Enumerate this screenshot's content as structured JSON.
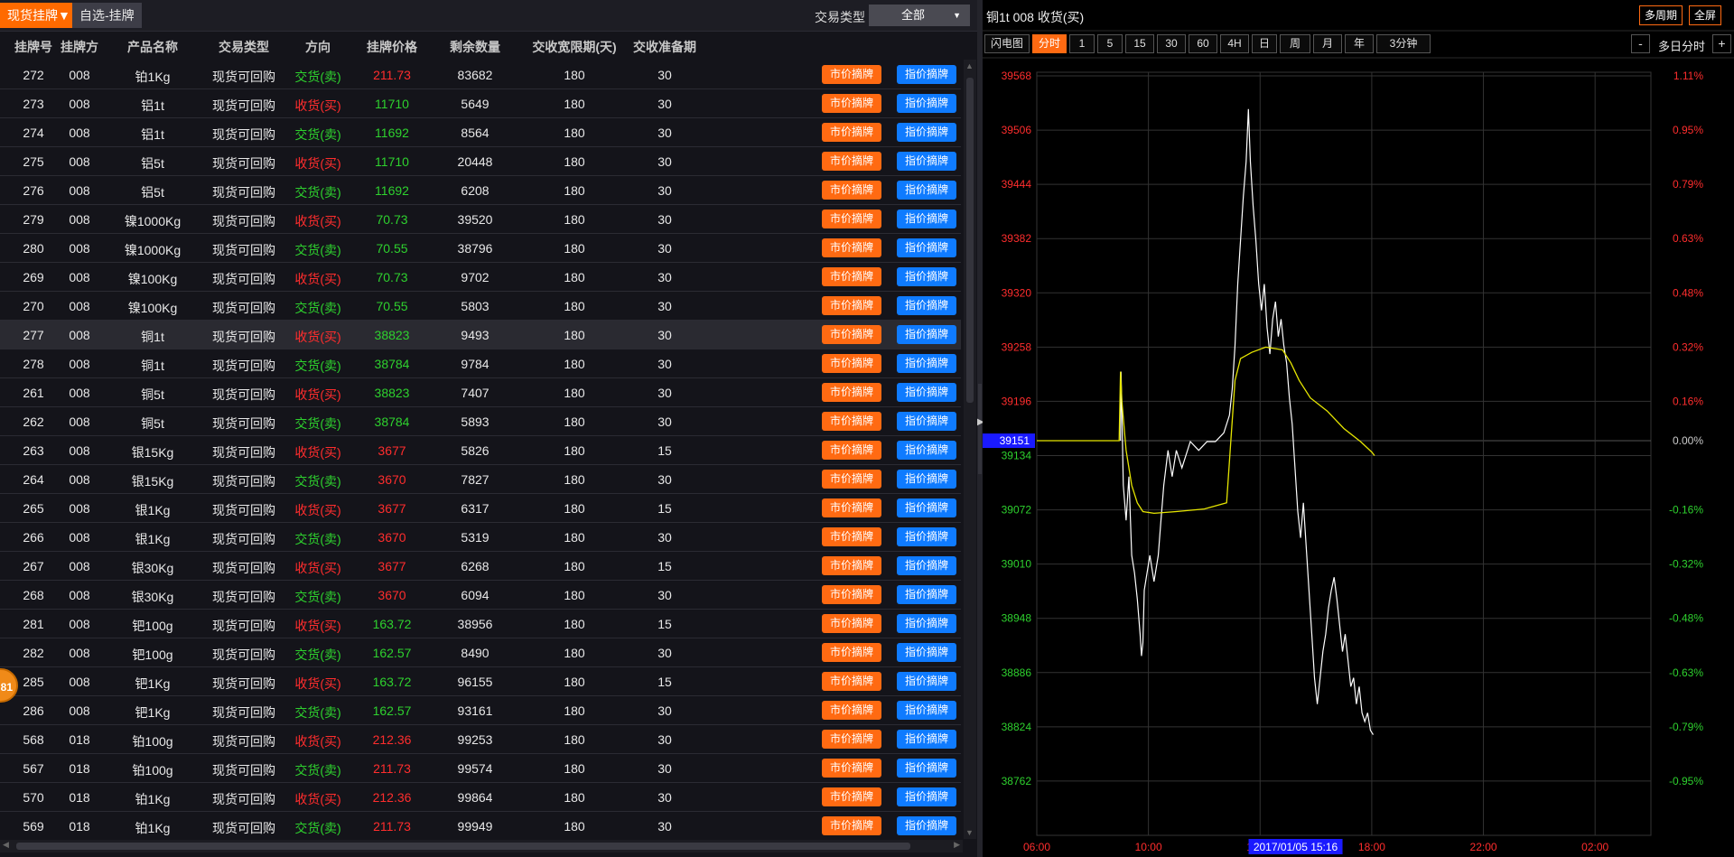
{
  "tabs": {
    "active": "现货挂牌▼",
    "other": "自选-挂牌"
  },
  "filter": {
    "label": "交易类型",
    "selected": "全部"
  },
  "table": {
    "headers": [
      "挂牌号",
      "挂牌方",
      "产品名称",
      "交易类型",
      "方向",
      "挂牌价格",
      "剩余数量",
      "交收宽限期(天)",
      "交收准备期"
    ],
    "buttons": {
      "market": "市价摘牌",
      "limit": "指价摘牌"
    },
    "rows": [
      {
        "id": "272",
        "party": "008",
        "product": "铂1Kg",
        "type": "现货可回购",
        "dir": "交货(卖)",
        "price": "211.73",
        "qty": "83682",
        "grace": "180",
        "prep": "30",
        "dirColor": "#2ed12e",
        "priceColor": "#ff2d2d"
      },
      {
        "id": "273",
        "party": "008",
        "product": "铝1t",
        "type": "现货可回购",
        "dir": "收货(买)",
        "price": "11710",
        "qty": "5649",
        "grace": "180",
        "prep": "30",
        "dirColor": "#ff2d2d",
        "priceColor": "#2ed12e"
      },
      {
        "id": "274",
        "party": "008",
        "product": "铝1t",
        "type": "现货可回购",
        "dir": "交货(卖)",
        "price": "11692",
        "qty": "8564",
        "grace": "180",
        "prep": "30",
        "dirColor": "#2ed12e",
        "priceColor": "#2ed12e"
      },
      {
        "id": "275",
        "party": "008",
        "product": "铝5t",
        "type": "现货可回购",
        "dir": "收货(买)",
        "price": "11710",
        "qty": "20448",
        "grace": "180",
        "prep": "30",
        "dirColor": "#ff2d2d",
        "priceColor": "#2ed12e"
      },
      {
        "id": "276",
        "party": "008",
        "product": "铝5t",
        "type": "现货可回购",
        "dir": "交货(卖)",
        "price": "11692",
        "qty": "6208",
        "grace": "180",
        "prep": "30",
        "dirColor": "#2ed12e",
        "priceColor": "#2ed12e"
      },
      {
        "id": "279",
        "party": "008",
        "product": "镍1000Kg",
        "type": "现货可回购",
        "dir": "收货(买)",
        "price": "70.73",
        "qty": "39520",
        "grace": "180",
        "prep": "30",
        "dirColor": "#ff2d2d",
        "priceColor": "#2ed12e"
      },
      {
        "id": "280",
        "party": "008",
        "product": "镍1000Kg",
        "type": "现货可回购",
        "dir": "交货(卖)",
        "price": "70.55",
        "qty": "38796",
        "grace": "180",
        "prep": "30",
        "dirColor": "#2ed12e",
        "priceColor": "#2ed12e"
      },
      {
        "id": "269",
        "party": "008",
        "product": "镍100Kg",
        "type": "现货可回购",
        "dir": "收货(买)",
        "price": "70.73",
        "qty": "9702",
        "grace": "180",
        "prep": "30",
        "dirColor": "#ff2d2d",
        "priceColor": "#2ed12e"
      },
      {
        "id": "270",
        "party": "008",
        "product": "镍100Kg",
        "type": "现货可回购",
        "dir": "交货(卖)",
        "price": "70.55",
        "qty": "5803",
        "grace": "180",
        "prep": "30",
        "dirColor": "#2ed12e",
        "priceColor": "#2ed12e"
      },
      {
        "id": "277",
        "party": "008",
        "product": "铜1t",
        "type": "现货可回购",
        "dir": "收货(买)",
        "price": "38823",
        "qty": "9493",
        "grace": "180",
        "prep": "30",
        "dirColor": "#ff2d2d",
        "priceColor": "#2ed12e",
        "selected": true
      },
      {
        "id": "278",
        "party": "008",
        "product": "铜1t",
        "type": "现货可回购",
        "dir": "交货(卖)",
        "price": "38784",
        "qty": "9784",
        "grace": "180",
        "prep": "30",
        "dirColor": "#2ed12e",
        "priceColor": "#2ed12e"
      },
      {
        "id": "261",
        "party": "008",
        "product": "铜5t",
        "type": "现货可回购",
        "dir": "收货(买)",
        "price": "38823",
        "qty": "7407",
        "grace": "180",
        "prep": "30",
        "dirColor": "#ff2d2d",
        "priceColor": "#2ed12e"
      },
      {
        "id": "262",
        "party": "008",
        "product": "铜5t",
        "type": "现货可回购",
        "dir": "交货(卖)",
        "price": "38784",
        "qty": "5893",
        "grace": "180",
        "prep": "30",
        "dirColor": "#2ed12e",
        "priceColor": "#2ed12e"
      },
      {
        "id": "263",
        "party": "008",
        "product": "银15Kg",
        "type": "现货可回购",
        "dir": "收货(买)",
        "price": "3677",
        "qty": "5826",
        "grace": "180",
        "prep": "15",
        "dirColor": "#ff2d2d",
        "priceColor": "#ff2d2d"
      },
      {
        "id": "264",
        "party": "008",
        "product": "银15Kg",
        "type": "现货可回购",
        "dir": "交货(卖)",
        "price": "3670",
        "qty": "7827",
        "grace": "180",
        "prep": "30",
        "dirColor": "#2ed12e",
        "priceColor": "#ff2d2d"
      },
      {
        "id": "265",
        "party": "008",
        "product": "银1Kg",
        "type": "现货可回购",
        "dir": "收货(买)",
        "price": "3677",
        "qty": "6317",
        "grace": "180",
        "prep": "15",
        "dirColor": "#ff2d2d",
        "priceColor": "#ff2d2d"
      },
      {
        "id": "266",
        "party": "008",
        "product": "银1Kg",
        "type": "现货可回购",
        "dir": "交货(卖)",
        "price": "3670",
        "qty": "5319",
        "grace": "180",
        "prep": "30",
        "dirColor": "#2ed12e",
        "priceColor": "#ff2d2d"
      },
      {
        "id": "267",
        "party": "008",
        "product": "银30Kg",
        "type": "现货可回购",
        "dir": "收货(买)",
        "price": "3677",
        "qty": "6268",
        "grace": "180",
        "prep": "15",
        "dirColor": "#ff2d2d",
        "priceColor": "#ff2d2d"
      },
      {
        "id": "268",
        "party": "008",
        "product": "银30Kg",
        "type": "现货可回购",
        "dir": "交货(卖)",
        "price": "3670",
        "qty": "6094",
        "grace": "180",
        "prep": "30",
        "dirColor": "#2ed12e",
        "priceColor": "#ff2d2d"
      },
      {
        "id": "281",
        "party": "008",
        "product": "钯100g",
        "type": "现货可回购",
        "dir": "收货(买)",
        "price": "163.72",
        "qty": "38956",
        "grace": "180",
        "prep": "15",
        "dirColor": "#ff2d2d",
        "priceColor": "#2ed12e"
      },
      {
        "id": "282",
        "party": "008",
        "product": "钯100g",
        "type": "现货可回购",
        "dir": "交货(卖)",
        "price": "162.57",
        "qty": "8490",
        "grace": "180",
        "prep": "30",
        "dirColor": "#2ed12e",
        "priceColor": "#2ed12e"
      },
      {
        "id": "285",
        "party": "008",
        "product": "钯1Kg",
        "type": "现货可回购",
        "dir": "收货(买)",
        "price": "163.72",
        "qty": "96155",
        "grace": "180",
        "prep": "15",
        "dirColor": "#ff2d2d",
        "priceColor": "#2ed12e"
      },
      {
        "id": "286",
        "party": "008",
        "product": "钯1Kg",
        "type": "现货可回购",
        "dir": "交货(卖)",
        "price": "162.57",
        "qty": "93161",
        "grace": "180",
        "prep": "30",
        "dirColor": "#2ed12e",
        "priceColor": "#2ed12e"
      },
      {
        "id": "568",
        "party": "018",
        "product": "铂100g",
        "type": "现货可回购",
        "dir": "收货(买)",
        "price": "212.36",
        "qty": "99253",
        "grace": "180",
        "prep": "30",
        "dirColor": "#ff2d2d",
        "priceColor": "#ff2d2d"
      },
      {
        "id": "567",
        "party": "018",
        "product": "铂100g",
        "type": "现货可回购",
        "dir": "交货(卖)",
        "price": "211.73",
        "qty": "99574",
        "grace": "180",
        "prep": "30",
        "dirColor": "#2ed12e",
        "priceColor": "#ff2d2d"
      },
      {
        "id": "570",
        "party": "018",
        "product": "铂1Kg",
        "type": "现货可回购",
        "dir": "收货(买)",
        "price": "212.36",
        "qty": "99864",
        "grace": "180",
        "prep": "30",
        "dirColor": "#ff2d2d",
        "priceColor": "#ff2d2d"
      },
      {
        "id": "569",
        "party": "018",
        "product": "铂1Kg",
        "type": "现货可回购",
        "dir": "交货(卖)",
        "price": "211.73",
        "qty": "99949",
        "grace": "180",
        "prep": "30",
        "dirColor": "#2ed12e",
        "priceColor": "#ff2d2d"
      }
    ]
  },
  "float_badge": "81",
  "chart_panel": {
    "title": "铜1t 008 收货(买)",
    "multi_period": "多周期",
    "fullscreen": "全屏",
    "flash_chart": "闪电图",
    "periods": [
      "分时",
      "1",
      "5",
      "15",
      "30",
      "60",
      "4H",
      "日",
      "周",
      "月",
      "年",
      "3分钟"
    ],
    "active_period": "分时",
    "minus": "-",
    "plus": "+",
    "multi_day": "多日分时"
  },
  "chart_data": {
    "type": "line",
    "y_ticks": [
      39568,
      39506,
      39444,
      39382,
      39320,
      39258,
      39196,
      39134,
      39072,
      39010,
      38948,
      38886,
      38824,
      38762
    ],
    "ylim": [
      38700,
      39568
    ],
    "pct_ticks_up": [
      "1.11%",
      "0.95%",
      "0.79%",
      "0.63%",
      "0.48%",
      "0.32%",
      "0.16%"
    ],
    "pct_zero": "0.00%",
    "pct_ticks_down": [
      "-0.16%",
      "-0.32%",
      "-0.48%",
      "-0.63%",
      "-0.79%",
      "-0.95%"
    ],
    "prev_close": 39151,
    "x_ticks": [
      "06:00",
      "10:00",
      "14:00",
      "18:00",
      "22:00",
      "02:00"
    ],
    "xlim": [
      6,
      28
    ],
    "crosshair_time": "2017/01/05 15:16",
    "crosshair_x": 15.27,
    "colors": {
      "price": "#ffffff",
      "average": "#e6e600",
      "up": "#ff2d2d",
      "down": "#2ed12e",
      "grid": "#333333",
      "zero": "#555555"
    },
    "series": [
      {
        "name": "",
        "kind": "price",
        "points": [
          [
            9.0,
            39151
          ],
          [
            9.02,
            39230
          ],
          [
            9.05,
            39180
          ],
          [
            9.1,
            39100
          ],
          [
            9.2,
            39060
          ],
          [
            9.3,
            39110
          ],
          [
            9.4,
            39020
          ],
          [
            9.5,
            39000
          ],
          [
            9.6,
            38970
          ],
          [
            9.7,
            38930
          ],
          [
            9.75,
            38905
          ],
          [
            9.8,
            38920
          ],
          [
            9.85,
            38980
          ],
          [
            9.95,
            39000
          ],
          [
            10.05,
            39020
          ],
          [
            10.2,
            38990
          ],
          [
            10.35,
            39020
          ],
          [
            10.45,
            39060
          ],
          [
            10.55,
            39100
          ],
          [
            10.7,
            39140
          ],
          [
            10.85,
            39110
          ],
          [
            11.0,
            39140
          ],
          [
            11.2,
            39120
          ],
          [
            11.5,
            39150
          ],
          [
            11.8,
            39140
          ],
          [
            12.1,
            39150
          ],
          [
            12.4,
            39150
          ],
          [
            12.7,
            39160
          ],
          [
            12.9,
            39180
          ],
          [
            13.0,
            39210
          ],
          [
            13.1,
            39260
          ],
          [
            13.2,
            39330
          ],
          [
            13.3,
            39380
          ],
          [
            13.4,
            39430
          ],
          [
            13.5,
            39470
          ],
          [
            13.58,
            39530
          ],
          [
            13.65,
            39470
          ],
          [
            13.75,
            39420
          ],
          [
            13.85,
            39380
          ],
          [
            13.95,
            39330
          ],
          [
            14.05,
            39300
          ],
          [
            14.15,
            39330
          ],
          [
            14.25,
            39280
          ],
          [
            14.35,
            39250
          ],
          [
            14.45,
            39290
          ],
          [
            14.55,
            39310
          ],
          [
            14.65,
            39270
          ],
          [
            14.75,
            39290
          ],
          [
            14.85,
            39260
          ],
          [
            14.95,
            39240
          ],
          [
            15.05,
            39200
          ],
          [
            15.15,
            39170
          ],
          [
            15.25,
            39120
          ],
          [
            15.35,
            39070
          ],
          [
            15.45,
            39040
          ],
          [
            15.55,
            39080
          ],
          [
            15.65,
            39030
          ],
          [
            15.75,
            38980
          ],
          [
            15.85,
            38930
          ],
          [
            15.95,
            38880
          ],
          [
            16.05,
            38850
          ],
          [
            16.15,
            38880
          ],
          [
            16.25,
            38910
          ],
          [
            16.35,
            38930
          ],
          [
            16.45,
            38960
          ],
          [
            16.55,
            38980
          ],
          [
            16.65,
            38995
          ],
          [
            16.75,
            38970
          ],
          [
            16.85,
            38940
          ],
          [
            16.95,
            38910
          ],
          [
            17.05,
            38930
          ],
          [
            17.15,
            38900
          ],
          [
            17.25,
            38870
          ],
          [
            17.35,
            38880
          ],
          [
            17.45,
            38850
          ],
          [
            17.55,
            38870
          ],
          [
            17.65,
            38840
          ],
          [
            17.75,
            38830
          ],
          [
            17.85,
            38840
          ],
          [
            17.95,
            38820
          ],
          [
            18.05,
            38815
          ]
        ]
      },
      {
        "name": "",
        "kind": "average",
        "points": [
          [
            6.0,
            39151
          ],
          [
            8.95,
            39151
          ],
          [
            9.0,
            39230
          ],
          [
            9.05,
            39195
          ],
          [
            9.2,
            39140
          ],
          [
            9.4,
            39100
          ],
          [
            9.6,
            39080
          ],
          [
            9.8,
            39070
          ],
          [
            10.2,
            39068
          ],
          [
            11.0,
            39070
          ],
          [
            12.0,
            39073
          ],
          [
            12.8,
            39080
          ],
          [
            12.95,
            39150
          ],
          [
            13.1,
            39220
          ],
          [
            13.3,
            39245
          ],
          [
            13.7,
            39252
          ],
          [
            14.2,
            39258
          ],
          [
            14.8,
            39255
          ],
          [
            15.1,
            39240
          ],
          [
            15.4,
            39220
          ],
          [
            15.8,
            39200
          ],
          [
            16.4,
            39185
          ],
          [
            17.0,
            39165
          ],
          [
            17.6,
            39150
          ],
          [
            18.0,
            39138
          ],
          [
            18.1,
            39134
          ]
        ]
      }
    ]
  }
}
